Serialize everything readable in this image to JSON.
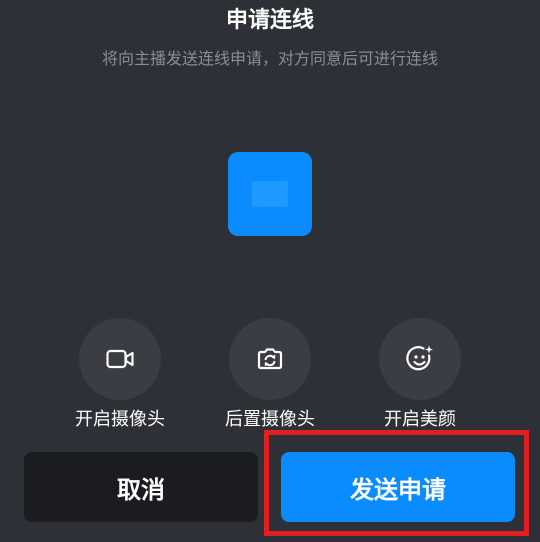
{
  "dialog": {
    "title": "申请连线",
    "subtitle": "将向主播发送连线申请，对方同意后可进行连线"
  },
  "options": [
    {
      "label": "开启摄像头",
      "icon": "video-camera-icon"
    },
    {
      "label": "后置摄像头",
      "icon": "switch-camera-icon"
    },
    {
      "label": "开启美颜",
      "icon": "beauty-face-icon"
    }
  ],
  "buttons": {
    "cancel_label": "取消",
    "send_label": "发送申请"
  },
  "colors": {
    "background": "#2d3036",
    "accent": "#0a8cff",
    "highlight": "#e02020"
  }
}
